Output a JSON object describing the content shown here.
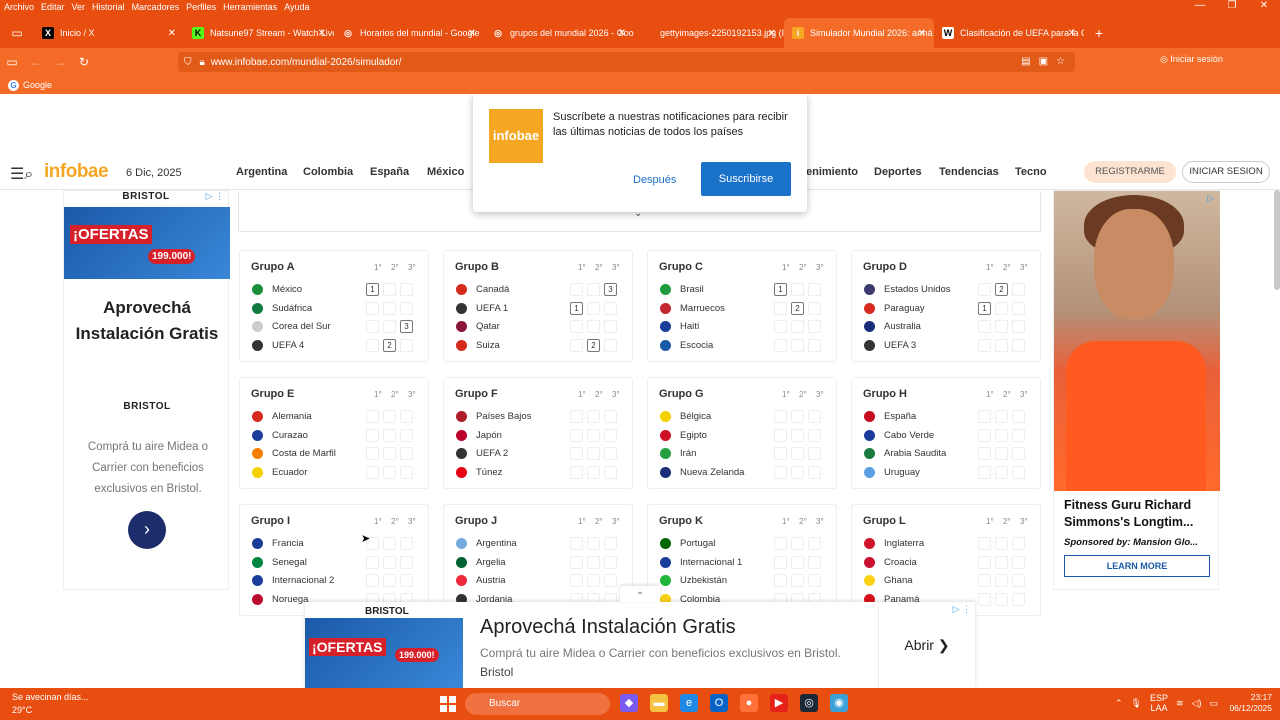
{
  "menubar": {
    "items": [
      "Archivo",
      "Editar",
      "Ver",
      "Historial",
      "Marcadores",
      "Perfiles",
      "Herramientas",
      "Ayuda"
    ]
  },
  "tabs": [
    {
      "label": "Inicio / X",
      "icon": "x-icon"
    },
    {
      "label": "Natsune97 Stream - Watch Live",
      "icon": "kick-icon"
    },
    {
      "label": "Horarios del mundial - Google",
      "icon": "globe-icon"
    },
    {
      "label": "grupos del mundial 2026 - Goo",
      "icon": "globe-icon"
    },
    {
      "label": "gettyimages-2250192153.jpg (Imag",
      "icon": "image-icon"
    },
    {
      "label": "Simulador Mundial 2026: armá",
      "icon": "infobae-icon"
    },
    {
      "label": "Clasificación de UEFA para la Co",
      "icon": "wikipedia-icon"
    }
  ],
  "url": "www.infobae.com/mundial-2026/simulador/",
  "signin": "Iniciar sesión",
  "bookmark": "Google",
  "popup": {
    "logo": "infobae",
    "text": "Suscríbete a nuestras notificaciones para recibir las últimas noticias de todos los países",
    "later": "Después",
    "subscribe": "Suscribirse"
  },
  "site": {
    "logo": "infobae",
    "date": "6 Dic, 2025",
    "nav": [
      "Argentina",
      "Colombia",
      "España",
      "México",
      "enimiento",
      "Deportes",
      "Tendencias",
      "Tecno"
    ],
    "register": "REGISTRARME",
    "login": "INICIAR SESION"
  },
  "leftad": {
    "brand": "BRISTOL",
    "offer": "¡OFERTAS",
    "price": "199.000!",
    "headline": "Aprovechá Instalación Gratis",
    "text": "Comprá tu aire Midea o Carrier con beneficios exclusivos en Bristol."
  },
  "rightad": {
    "title": "Fitness Guru Richard Simmons's Longtim...",
    "sponsor": "Sponsored by: Mansion Glo...",
    "cta": "LEARN MORE"
  },
  "botad": {
    "brand": "BRISTOL",
    "offer": "¡OFERTAS",
    "price": "199.000!",
    "headline": "Aprovechá Instalación Gratis",
    "desc": "Comprá tu aire Midea o Carrier con beneficios exclusivos en Bristol.",
    "sponsor": "Bristol",
    "open": "Abrir ❯"
  },
  "pos_headers": [
    "1°",
    "2°",
    "3°"
  ],
  "groups": [
    {
      "name": "Grupo A",
      "teams": [
        {
          "n": "México",
          "p": 1,
          "c": "#1a8f3a"
        },
        {
          "n": "Sudáfrica",
          "p": 0,
          "c": "#117a3e"
        },
        {
          "n": "Corea del Sur",
          "p": 3,
          "c": "#cccccc"
        },
        {
          "n": "UEFA 4",
          "p": 2,
          "c": "#333333"
        }
      ]
    },
    {
      "name": "Grupo B",
      "teams": [
        {
          "n": "Canadá",
          "p": 3,
          "c": "#d52b1e"
        },
        {
          "n": "UEFA 1",
          "p": 1,
          "c": "#333333"
        },
        {
          "n": "Qatar",
          "p": 0,
          "c": "#8a1538"
        },
        {
          "n": "Suiza",
          "p": 2,
          "c": "#d52b1e"
        }
      ]
    },
    {
      "name": "Grupo C",
      "teams": [
        {
          "n": "Brasil",
          "p": 1,
          "c": "#1f9a3e"
        },
        {
          "n": "Marruecos",
          "p": 2,
          "c": "#c1272d"
        },
        {
          "n": "Haití",
          "p": 0,
          "c": "#1a3d9a"
        },
        {
          "n": "Escocia",
          "p": 0,
          "c": "#1a5aa8"
        }
      ]
    },
    {
      "name": "Grupo D",
      "teams": [
        {
          "n": "Estados Unidos",
          "p": 2,
          "c": "#3c3b6e"
        },
        {
          "n": "Paraguay",
          "p": 1,
          "c": "#d52b1e"
        },
        {
          "n": "Australia",
          "p": 0,
          "c": "#1a2d7a"
        },
        {
          "n": "UEFA 3",
          "p": 0,
          "c": "#333333"
        }
      ]
    },
    {
      "name": "Grupo E",
      "teams": [
        {
          "n": "Alemania",
          "p": 0,
          "c": "#d52b1e"
        },
        {
          "n": "Curazao",
          "p": 0,
          "c": "#1a3d9a"
        },
        {
          "n": "Costa de Marfil",
          "p": 0,
          "c": "#f77f00"
        },
        {
          "n": "Ecuador",
          "p": 0,
          "c": "#f5d100"
        }
      ]
    },
    {
      "name": "Grupo F",
      "teams": [
        {
          "n": "Países Bajos",
          "p": 0,
          "c": "#ae1c28"
        },
        {
          "n": "Japón",
          "p": 0,
          "c": "#bc002d"
        },
        {
          "n": "UEFA 2",
          "p": 0,
          "c": "#333333"
        },
        {
          "n": "Túnez",
          "p": 0,
          "c": "#e70013"
        }
      ]
    },
    {
      "name": "Grupo G",
      "teams": [
        {
          "n": "Bélgica",
          "p": 0,
          "c": "#f5d100"
        },
        {
          "n": "Egipto",
          "p": 0,
          "c": "#ce1126"
        },
        {
          "n": "Irán",
          "p": 0,
          "c": "#239f40"
        },
        {
          "n": "Nueva Zelanda",
          "p": 0,
          "c": "#1a2d7a"
        }
      ]
    },
    {
      "name": "Grupo H",
      "teams": [
        {
          "n": "España",
          "p": 0,
          "c": "#c60b1e"
        },
        {
          "n": "Cabo Verde",
          "p": 0,
          "c": "#1a3d9a"
        },
        {
          "n": "Arabia Saudita",
          "p": 0,
          "c": "#1a7a3e"
        },
        {
          "n": "Uruguay",
          "p": 0,
          "c": "#5aa0e0"
        }
      ]
    },
    {
      "name": "Grupo I",
      "teams": [
        {
          "n": "Francia",
          "p": 0,
          "c": "#1a3d9a"
        },
        {
          "n": "Senegal",
          "p": 0,
          "c": "#00853f"
        },
        {
          "n": "Internacional 2",
          "p": 0,
          "c": "#1a3d9a"
        },
        {
          "n": "Noruega",
          "p": 0,
          "c": "#ba0c2f"
        }
      ]
    },
    {
      "name": "Grupo J",
      "teams": [
        {
          "n": "Argentina",
          "p": 0,
          "c": "#74acdf"
        },
        {
          "n": "Argelia",
          "p": 0,
          "c": "#006233"
        },
        {
          "n": "Austria",
          "p": 0,
          "c": "#ed2939"
        },
        {
          "n": "Jordania",
          "p": 0,
          "c": "#333333"
        }
      ]
    },
    {
      "name": "Grupo K",
      "teams": [
        {
          "n": "Portugal",
          "p": 0,
          "c": "#006600"
        },
        {
          "n": "Internacional 1",
          "p": 0,
          "c": "#1a3d9a"
        },
        {
          "n": "Uzbekistán",
          "p": 0,
          "c": "#1eb53a"
        },
        {
          "n": "Colombia",
          "p": 0,
          "c": "#fcd116"
        }
      ]
    },
    {
      "name": "Grupo L",
      "teams": [
        {
          "n": "Inglaterra",
          "p": 0,
          "c": "#cf142b"
        },
        {
          "n": "Croacia",
          "p": 0,
          "c": "#c8102e"
        },
        {
          "n": "Ghana",
          "p": 0,
          "c": "#fcd116"
        },
        {
          "n": "Panamá",
          "p": 0,
          "c": "#da121a"
        }
      ]
    }
  ],
  "taskbar": {
    "weather_text": "Se avecinan días...",
    "temp": "29°C",
    "search": "Buscar",
    "lang1": "ESP",
    "lang2": "LAA",
    "time": "23:17",
    "date": "06/12/2025"
  }
}
